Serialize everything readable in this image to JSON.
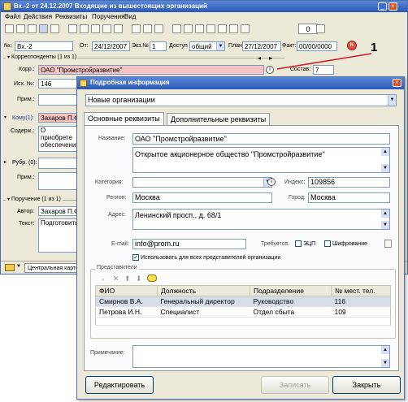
{
  "main_window": {
    "title": "Вх.-2 от 24.12.2007 Входящие из вышестоящих организаций",
    "menu": [
      "Файл",
      "Действия",
      "Реквизиты",
      "Поручения",
      "Вид"
    ],
    "toolbar_zero": "0",
    "header": {
      "num_label": "№:",
      "num_value": "Вх.-2",
      "from_label": "От:",
      "from_value": "24/12/2007",
      "copy_label": "Экз.№",
      "copy_value": "1",
      "access_label": "Доступ",
      "access_value": "общий",
      "plan_label": "План:",
      "plan_value": "27/12/2007",
      "fact_label": "Факт:",
      "fact_value": "00/00/0000"
    },
    "correspondents_header": "Корреспонденты (1 из 1)",
    "corr_label": "Корр.:",
    "corr_value": "ОАО \"Промстройразвитие\"",
    "ish_label": "Исх. №:",
    "ish_value": "146",
    "prim_label": "Прим.:",
    "sostav_label": "Состав:",
    "sostav_value": "7",
    "komu_label": "Кому(1):",
    "komu_value": "Захаров П.Ф.",
    "soderzh_label": "Содерж.:",
    "soderzh_value": "О приобрете обеспечения",
    "rubr_label": "Рубр. (0):",
    "prim2_label": "Прим.:",
    "poruch_header": "Поручение (1 из 1)",
    "avtor_label": "Автор:",
    "avtor_value": "Захаров П.Ф.",
    "tekst_label": "Текст:",
    "tekst_value": "Подготовить",
    "status_tab": "Центральная карто",
    "annotation_number": "1"
  },
  "dialog": {
    "title": "Подробная информация",
    "group_value": "Новые организации",
    "tabs": [
      "Основные реквизиты",
      "Дополнительные реквизиты"
    ],
    "name_label": "Название:",
    "name_value": "ОАО \"Промстройразвитие\"",
    "fullname_value": "Открытое акционерное общество \"Промстройразвитие\"",
    "category_label": "Категория:",
    "category_value": "",
    "index_label": "Индекс:",
    "index_value": "109856",
    "region_label": "Регион:",
    "region_value": "Москва",
    "city_label": "Город:",
    "city_value": "Москва",
    "address_label": "Адрес:",
    "address_value": "Ленинский просп., д. 68/1",
    "email_label": "E-mail:",
    "email_value": "info@prom.ru",
    "required_label": "Требуется:",
    "ecp_label": "ЭЦП",
    "encrypt_label": "Шифрование",
    "use_all_label": "Использовать для всех представителей организации",
    "reps_header": "Представители",
    "reps_columns": [
      "ФИО",
      "Должность",
      "Подразделение",
      "№ мест. тел."
    ],
    "reps_rows": [
      [
        "Смирнов В.А.",
        "Генеральный директор",
        "Руководство",
        "116"
      ],
      [
        "Петрова И.Н.",
        "Специалист",
        "Отдел сбыта",
        "109"
      ]
    ],
    "note_label": "Примечание:",
    "edit_button": "Редактировать",
    "save_button": "Записать",
    "close_button": "Закрыть"
  },
  "colors": {
    "title_blue": "#2b58b5",
    "pink_field": "#f7c3c3",
    "annotation_red": "#d0202a"
  }
}
